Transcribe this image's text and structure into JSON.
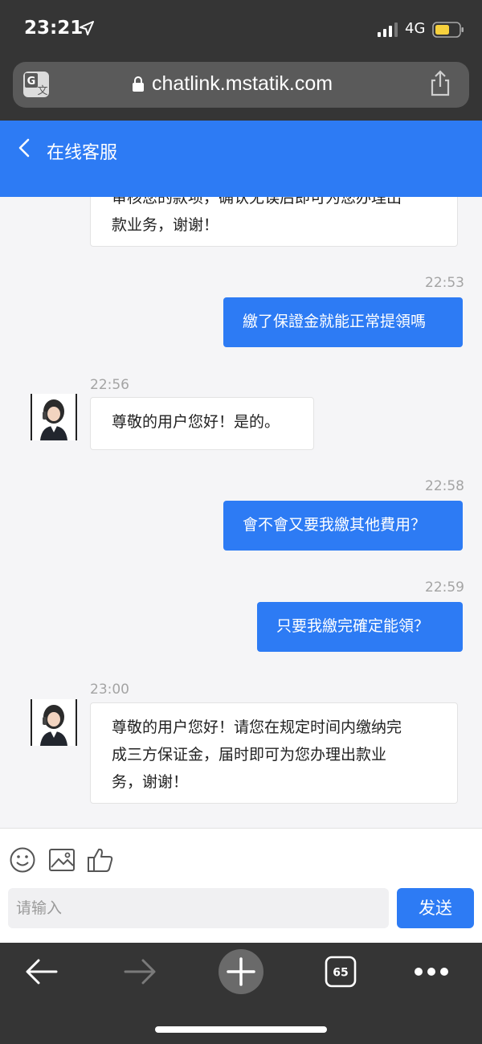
{
  "status_bar": {
    "time": "23:21",
    "network": "4G"
  },
  "browser": {
    "url": "chatlink.mstatik.com",
    "tab_count": "65"
  },
  "chat": {
    "header_title": "在线客服",
    "messages": [
      {
        "from": "agent",
        "text_line1": "审核您的款项，确认无误后即可为您办理出",
        "text_line2": "款业务，谢谢！"
      },
      {
        "from": "user",
        "time": "22:53",
        "text": "繳了保證金就能正常提領嗎"
      },
      {
        "from": "agent",
        "time": "22:56",
        "text": "尊敬的用户您好！是的。"
      },
      {
        "from": "user",
        "time": "22:58",
        "text": "會不會又要我繳其他費用？"
      },
      {
        "from": "user",
        "time": "22:59",
        "text": "只要我繳完確定能領？"
      },
      {
        "from": "agent",
        "time": "23:00",
        "text_line1": "尊敬的用户您好！请您在规定时间内缴纳完",
        "text_line2": "成三方保证金，届时即可为您办理出款业",
        "text_line3": "务，谢谢！"
      }
    ]
  },
  "input": {
    "placeholder": "请输入",
    "send_label": "发送"
  },
  "colors": {
    "accent": "#2d7bf4",
    "chrome": "#353535",
    "background": "#f5f5f7"
  }
}
